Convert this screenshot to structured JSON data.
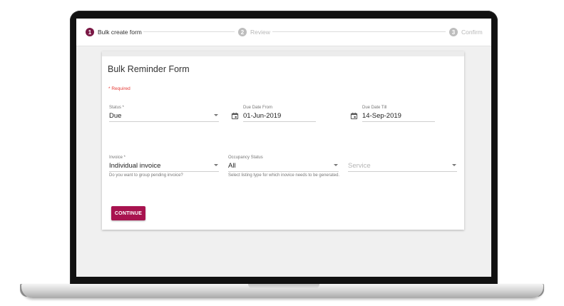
{
  "stepper": {
    "steps": [
      {
        "number": "1",
        "label": "Bulk create form",
        "state": "active"
      },
      {
        "number": "2",
        "label": "Review",
        "state": "idle"
      },
      {
        "number": "3",
        "label": "Confirm",
        "state": "idle"
      }
    ]
  },
  "form": {
    "title": "Bulk Reminder Form",
    "required_note": "* Required",
    "status": {
      "label": "Status *",
      "value": "Due"
    },
    "due_date_from": {
      "label": "Due Date From",
      "value": "01-Jun-2019",
      "icon": "calendar-icon"
    },
    "due_date_till": {
      "label": "Due Date Till",
      "value": "14-Sep-2019",
      "icon": "calendar-icon"
    },
    "invoice": {
      "label": "Invoice *",
      "value": "Individual invoice",
      "hint": "Do you want to group pending invoice?"
    },
    "occupancy_status": {
      "label": "Occupancy Status",
      "value": "All",
      "hint": "Select listing type for which inovice needs to be generated."
    },
    "service": {
      "placeholder": "Service"
    },
    "continue_label": "CONTINUE"
  },
  "colors": {
    "accent": "#a8134f",
    "step_active": "#7a1845",
    "required": "#e53935"
  }
}
